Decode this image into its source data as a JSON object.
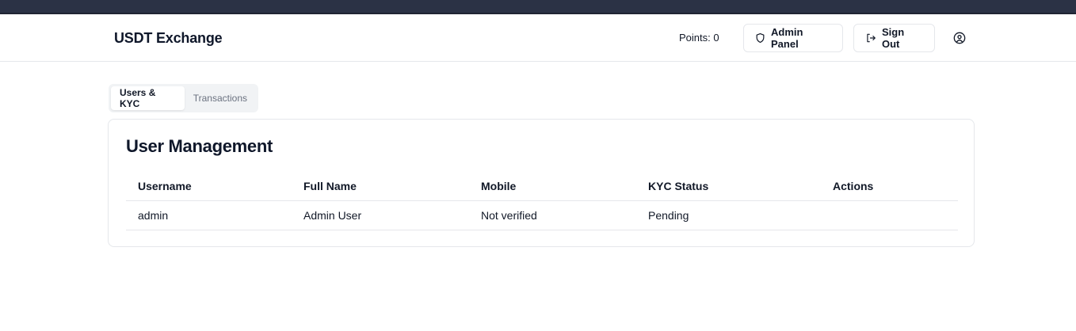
{
  "header": {
    "brand": "USDT Exchange",
    "points": "Points: 0",
    "admin_button": "Admin Panel",
    "signout_button": "Sign Out"
  },
  "icons": {
    "admin": "shield-icon",
    "signout": "log-out-icon",
    "user": "user-circle-icon"
  },
  "tabs": [
    {
      "label": "Users & KYC",
      "active": true
    },
    {
      "label": "Transactions",
      "active": false
    }
  ],
  "card": {
    "title": "User Management",
    "columns": [
      "Username",
      "Full Name",
      "Mobile",
      "KYC Status",
      "Actions"
    ],
    "rows": [
      [
        "admin",
        "Admin User",
        "Not verified",
        "Pending",
        ""
      ]
    ]
  },
  "colors": {
    "topbar": "#2b3245",
    "border": "#e5e7eb",
    "text": "#0f172a",
    "muted": "#6b7280"
  }
}
